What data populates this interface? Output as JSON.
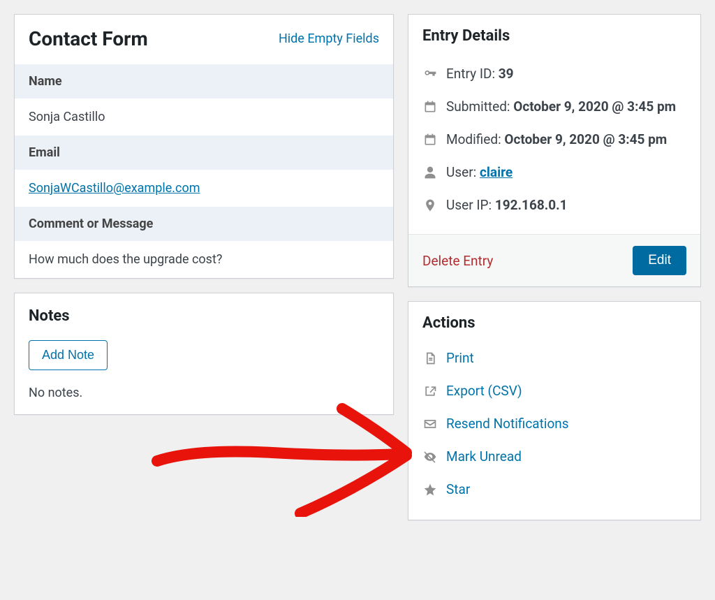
{
  "contactForm": {
    "title": "Contact Form",
    "hideEmpty": "Hide Empty Fields",
    "nameLabel": "Name",
    "nameValue": "Sonja Castillo",
    "emailLabel": "Email",
    "emailValue": "SonjaWCastillo@example.com",
    "commentLabel": "Comment or Message",
    "commentValue": "How much does the upgrade cost?"
  },
  "notes": {
    "title": "Notes",
    "addButton": "Add Note",
    "empty": "No notes."
  },
  "entryDetails": {
    "title": "Entry Details",
    "entryIdLabel": "Entry ID: ",
    "entryIdValue": "39",
    "submittedLabel": "Submitted: ",
    "submittedValue": "October 9, 2020 @ 3:45 pm",
    "modifiedLabel": "Modified: ",
    "modifiedValue": "October 9, 2020 @ 3:45 pm",
    "userLabel": "User: ",
    "userValue": "claire",
    "userIpLabel": "User IP: ",
    "userIpValue": "192.168.0.1",
    "deleteLabel": "Delete Entry",
    "editLabel": "Edit"
  },
  "actions": {
    "title": "Actions",
    "print": "Print",
    "export": "Export (CSV)",
    "resend": "Resend Notifications",
    "markUnread": "Mark Unread",
    "star": "Star"
  }
}
